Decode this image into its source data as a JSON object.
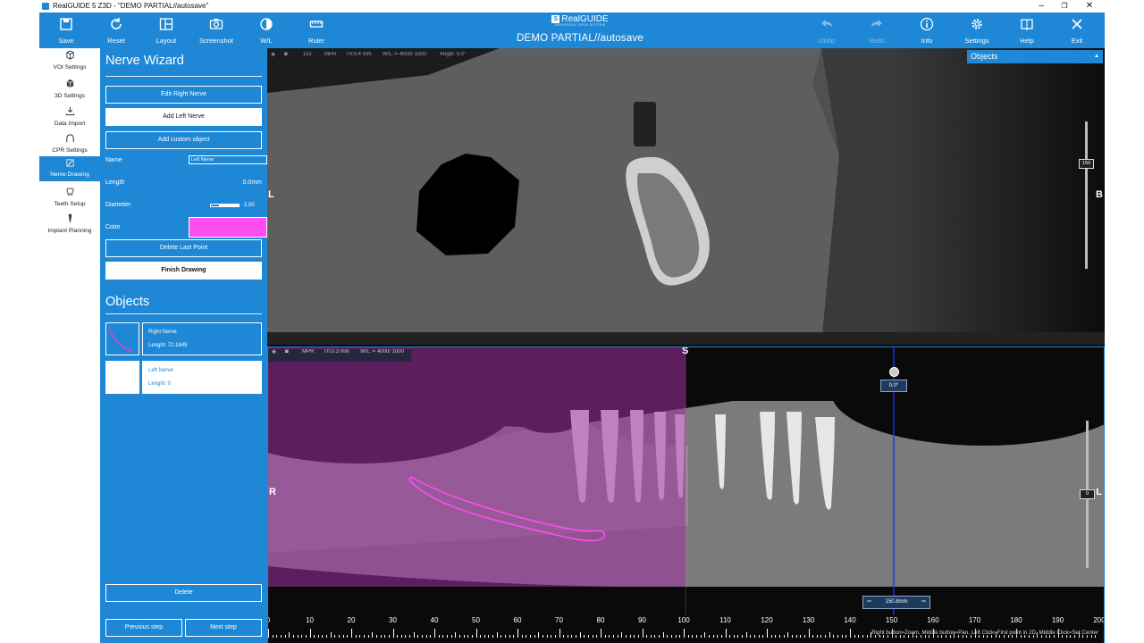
{
  "window": {
    "title": "RealGUIDE 5 Z3D  -  \"DEMO PARTIAL//autosave\""
  },
  "toolbar": {
    "save": "Save",
    "reset": "Reset",
    "layout": "Layout",
    "screenshot": "Screenshot",
    "wl": "W/L",
    "ruler": "Ruler",
    "logo": "RealGUIDE",
    "logo_sub": "UNIVERSAL OPEN SYSTEM",
    "project_title": "DEMO PARTIAL//autosave",
    "undo": "Undo",
    "redo": "Redo",
    "info": "Info",
    "settings": "Settings",
    "help": "Help",
    "exit": "Exit"
  },
  "sidebar": {
    "items": [
      {
        "label": "VOI Settings",
        "icon": "cube-icon"
      },
      {
        "label": "3D Settings",
        "icon": "cube-3d-icon"
      },
      {
        "label": "Data Import",
        "icon": "download-icon"
      },
      {
        "label": "CPR Settings",
        "icon": "arch-icon"
      },
      {
        "label": "Nerve Drawing",
        "icon": "nerve-icon",
        "active": true
      },
      {
        "label": "Teeth Setup",
        "icon": "tooth-icon"
      },
      {
        "label": "Implant Planning",
        "icon": "implant-icon"
      }
    ]
  },
  "wizard": {
    "title": "Nerve Wizard",
    "edit_right": "Edit Right Nerve",
    "add_left": "Add Left Nerve",
    "add_custom": "Add custom object",
    "name_label": "Name",
    "name_value": "Left Nerve",
    "length_label": "Length",
    "length_value": "0.0mm",
    "diameter_label": "Diameter",
    "diameter_value": "2,50",
    "diameter_fraction": 0.3,
    "color_label": "Color",
    "color_value": "#ff4df0",
    "delete_last": "Delete Last Point",
    "finish": "Finish Drawing",
    "objects_title": "Objects",
    "objects": [
      {
        "name": "Right Nerve",
        "length": "Lenght:  72.1849",
        "color": "#e040d8"
      },
      {
        "name": "Left Nerve",
        "length": "Lenght:  0",
        "color": "#ffffff"
      }
    ],
    "delete": "Delete",
    "prev": "Previous step",
    "next": "Next step"
  },
  "view_top": {
    "hdr": {
      "layout": "1x1",
      "mode": "MPR",
      "th": "Th:0.4 mm",
      "wl": "W/L := 4000/ 1000",
      "angle": "Angle: 0.0°"
    },
    "left": "L",
    "right": "B",
    "objects_dropdown": "Objects",
    "slider_value": "150"
  },
  "view_bottom": {
    "hdr": {
      "mode": "MPR",
      "th": "Th:0.3 mm",
      "wl": "W/L := 4000/ 1000"
    },
    "top": "S",
    "left": "R",
    "right": "L",
    "angle": "0.0°",
    "position": "150.8mm",
    "slider_value": "0",
    "ruler_labels": [
      "0",
      "10",
      "20",
      "30",
      "40",
      "50",
      "60",
      "70",
      "80",
      "90",
      "100",
      "110",
      "120",
      "130",
      "140",
      "150",
      "160",
      "170",
      "180",
      "190",
      "200"
    ],
    "hint": "Right button=Zoom, Middle button=Pan, Left Click=First point in 2D, Middle Click=Set Center"
  },
  "colors": {
    "accent": "#1e88d6",
    "nerve": "#ff4df0",
    "mask": "#a030a0"
  }
}
